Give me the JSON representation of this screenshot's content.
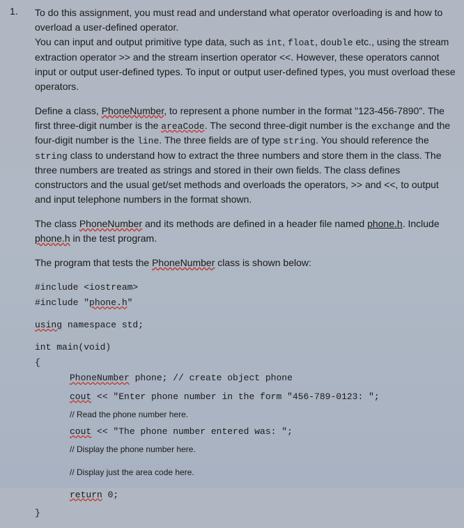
{
  "number": "1.",
  "paragraphs": {
    "p1_part1": "To do this assignment, you must read and understand what operator overloading is and how to overload a user-defined operator.",
    "p1_part2a": "You can input and output primitive type data, such as ",
    "p1_int": "int",
    "p1_comma1": ", ",
    "p1_float": "float",
    "p1_comma2": ", ",
    "p1_double": "double",
    "p1_part2b": " etc., using the stream extraction operator >> and the stream insertion operator <<.  However, these operators cannot input or output user-defined types. To input or output user-defined types, you must overload these operators.",
    "p2_a": "Define a class, ",
    "p2_phone": "PhoneNumber",
    "p2_b": ", to represent a phone number in the format \"123-456-7890\". The first three-digit number is the ",
    "p2_area": "areaCode",
    "p2_c": ". The second three-digit number is the ",
    "p2_exchange": "exchange",
    "p2_d": "  and the four-digit number is the ",
    "p2_line": "line",
    "p2_e": ". The three fields are of type ",
    "p2_string1": "string",
    "p2_f": ". You should reference the ",
    "p2_string2": "string",
    "p2_g": " class to understand how to extract the three numbers and store them in the class. The three numbers are treated as strings and stored in their own fields. The class defines constructors and the usual get/set methods and overloads the operators, >> and <<, to output and input telephone numbers in the format shown.",
    "p3_a": "The class ",
    "p3_phone": "PhoneNumber",
    "p3_b": "  and its methods are defined in a header file named ",
    "p3_phoneh": "phone.h",
    "p3_c": ". Include ",
    "p3_phoneh2": "phone.h",
    "p3_d": " in the test program.",
    "p4_a": "The program that tests the ",
    "p4_phone": "PhoneNumber",
    "p4_b": " class is shown below:"
  },
  "code": {
    "l1": "#include <iostream>",
    "l2_a": "#include \"",
    "l2_b": "phone.h",
    "l2_c": "\"",
    "l3_a": "using",
    "l3_b": " namespace std;",
    "l4": "int main(void)",
    "l5": "{",
    "l6_a": "PhoneNumber",
    "l6_b": " phone;    // create object phone",
    "l7_a": "cout",
    "l7_b": " << \"Enter phone number in the form \"456-789-0123: \";",
    "l8": "// Read the phone number here.",
    "l9_a": "cout",
    "l9_b": " << \"The phone number entered was: \";",
    "l10": "// Display the phone number here.",
    "l11": "// Display just the area code here.",
    "l12_a": "return",
    "l12_b": " 0;",
    "l13": "}"
  }
}
